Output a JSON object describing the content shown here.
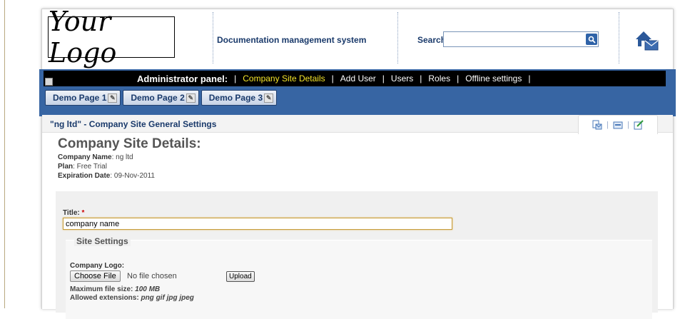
{
  "header": {
    "logo_text": "Your Logo",
    "app_title": "Documentation management system",
    "search_label": "Search:",
    "search_value": ""
  },
  "admin": {
    "title": "Administrator panel:",
    "links": [
      {
        "label": "Company Site Details",
        "active": true
      },
      {
        "label": "Add User"
      },
      {
        "label": "Users"
      },
      {
        "label": "Roles"
      },
      {
        "label": "Offline settings"
      }
    ]
  },
  "tabs": [
    "Demo Page 1",
    "Demo Page 2",
    "Demo Page 3"
  ],
  "section": {
    "title": "\"ng ltd\" - Company Site General Settings"
  },
  "details": {
    "heading": "Company Site Details:",
    "company_label": "Company Name",
    "company_value": ": ng ltd",
    "plan_label": "Plan",
    "plan_value": ": Free Trial",
    "expiration_label": "Expiration Date",
    "expiration_value": ": 09-Nov-2011"
  },
  "form": {
    "title_label": "Title:",
    "required_mark": "*",
    "title_value": "company name",
    "site_settings_legend": "Site Settings",
    "company_logo_label": "Company Logo:",
    "choose_file_label": "Choose File",
    "no_file_text": "No file chosen",
    "upload_label": "Upload",
    "max_size_label": "Maximum file size:",
    "max_size_value": "100 MB",
    "allowed_label": "Allowed extensions:",
    "allowed_value": "png gif jpg jpeg"
  },
  "colors": {
    "brand_blue": "#3765a3",
    "admin_bar": "#000000",
    "active_link": "#f5e52a",
    "heading_blue": "#1a3a6b"
  }
}
